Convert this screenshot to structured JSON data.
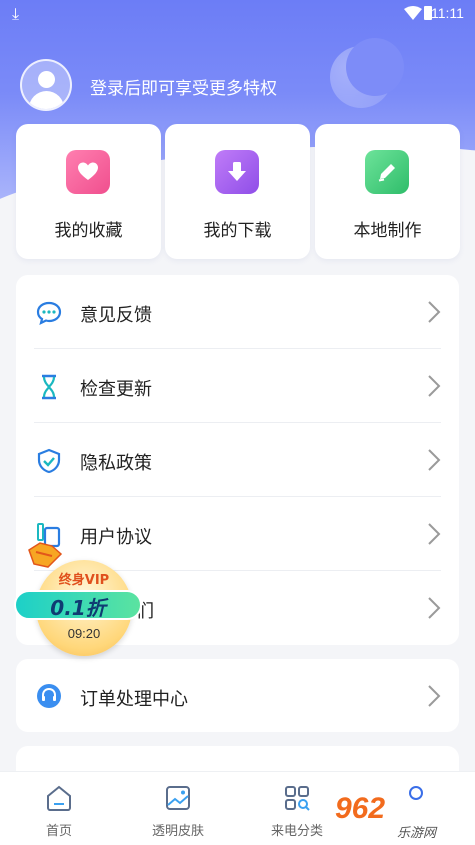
{
  "statusbar": {
    "time": "11:11"
  },
  "profile": {
    "login_prompt": "登录后即可享受更多特权"
  },
  "quick_actions": [
    {
      "label": "我的收藏",
      "icon": "heart-icon",
      "color": "#f25a9b"
    },
    {
      "label": "我的下载",
      "icon": "download-icon",
      "color": "#9b5cf0"
    },
    {
      "label": "本地制作",
      "icon": "pencil-icon",
      "color": "#41c878"
    }
  ],
  "menu": [
    {
      "label": "意见反馈",
      "icon": "chat-bubble-icon"
    },
    {
      "label": "检查更新",
      "icon": "hourglass-icon"
    },
    {
      "label": "隐私政策",
      "icon": "shield-check-icon"
    },
    {
      "label": "用户协议",
      "icon": "document-icon"
    },
    {
      "label": "们",
      "icon": "info-icon"
    }
  ],
  "order_center": {
    "label": "订单处理中心",
    "icon": "headset-icon"
  },
  "vip_promo": {
    "title": "终身VIP",
    "discount": "0.1折",
    "countdown": "09:20"
  },
  "tabbar": [
    {
      "label": "首页",
      "icon": "home-icon"
    },
    {
      "label": "透明皮肤",
      "icon": "picture-icon"
    },
    {
      "label": "来电分类",
      "icon": "grid-search-icon"
    },
    {
      "label": "",
      "icon": "profile-icon"
    }
  ],
  "watermark": {
    "number": "962",
    "text": "乐游网"
  },
  "colors": {
    "accent": "#6c7df6",
    "icon_blue": "#2a7de1",
    "icon_teal": "#1bb8c0"
  }
}
